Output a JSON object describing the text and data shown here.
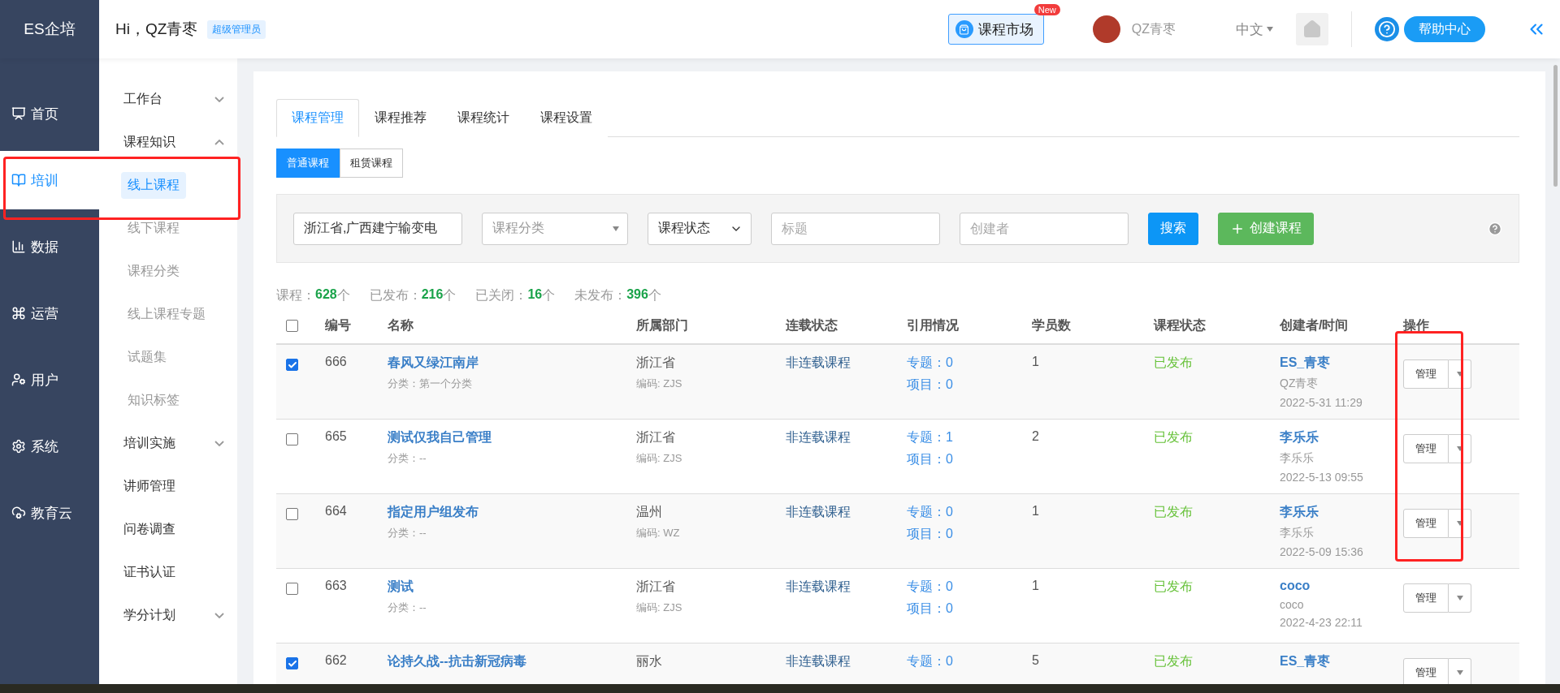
{
  "header": {
    "logo": "ES企培",
    "greeting": "Hi，QZ青枣",
    "role_badge": "超级管理员",
    "market_button": "课程市场",
    "market_badge": "New",
    "user_name": "QZ青枣",
    "language": "中文",
    "help_button": "帮助中心"
  },
  "nav": [
    {
      "label": "首页",
      "selected": false
    },
    {
      "label": "培训",
      "selected": true
    },
    {
      "label": "数据",
      "selected": false
    },
    {
      "label": "运营",
      "selected": false
    },
    {
      "label": "用户",
      "selected": false
    },
    {
      "label": "系统",
      "selected": false
    },
    {
      "label": "教育云",
      "selected": false
    }
  ],
  "subnav": [
    {
      "label": "工作台",
      "expanded": false
    },
    {
      "label": "课程知识",
      "expanded": true,
      "children": [
        {
          "label": "线上课程",
          "selected": true
        },
        {
          "label": "线下课程",
          "selected": false
        },
        {
          "label": "课程分类",
          "selected": false
        },
        {
          "label": "线上课程专题",
          "selected": false
        },
        {
          "label": "试题集",
          "selected": false
        },
        {
          "label": "知识标签",
          "selected": false
        }
      ]
    },
    {
      "label": "培训实施",
      "expanded": false
    },
    {
      "label": "讲师管理"
    },
    {
      "label": "问卷调查"
    },
    {
      "label": "证书认证"
    },
    {
      "label": "学分计划",
      "expanded": false
    }
  ],
  "tabs": [
    {
      "label": "课程管理",
      "selected": true
    },
    {
      "label": "课程推荐",
      "selected": false
    },
    {
      "label": "课程统计",
      "selected": false
    },
    {
      "label": "课程设置",
      "selected": false
    }
  ],
  "subtabs": [
    {
      "label": "普通课程",
      "selected": true
    },
    {
      "label": "租赁课程",
      "selected": false
    }
  ],
  "filters": {
    "department": "浙江省,广西建宁输变电",
    "category": "课程分类",
    "status": "课程状态",
    "title_placeholder": "标题",
    "creator_placeholder": "创建者",
    "search_button": "搜索",
    "create_button": "创建课程"
  },
  "stats": [
    {
      "label": "课程：",
      "value": "628",
      "unit": "个"
    },
    {
      "label": "已发布：",
      "value": "216",
      "unit": "个"
    },
    {
      "label": "已关闭：",
      "value": "16",
      "unit": "个"
    },
    {
      "label": "未发布：",
      "value": "396",
      "unit": "个"
    }
  ],
  "table": {
    "columns": [
      "编号",
      "名称",
      "所属部门",
      "连载状态",
      "引用情况",
      "学员数",
      "课程状态",
      "创建者/时间",
      "操作"
    ],
    "all_checked": false,
    "rows": [
      {
        "checked": true,
        "id": "666",
        "name": "春风又绿江南岸",
        "category": "分类：第一个分类",
        "dept": "浙江省",
        "dept_code": "编码: ZJS",
        "serial": "非连载课程",
        "topic": "专题：0",
        "project": "项目：0",
        "students": "1",
        "status": "已发布",
        "creator": "ES_青枣",
        "creator_sub": "QZ青枣",
        "time": "2022-5-31 11:29",
        "action": "管理"
      },
      {
        "checked": false,
        "id": "665",
        "name": "测试仅我自己管理",
        "category": "分类：--",
        "dept": "浙江省",
        "dept_code": "编码: ZJS",
        "serial": "非连载课程",
        "topic": "专题：1",
        "project": "项目：0",
        "students": "2",
        "status": "已发布",
        "creator": "李乐乐",
        "creator_sub": "李乐乐",
        "time": "2022-5-13 09:55",
        "action": "管理"
      },
      {
        "checked": false,
        "id": "664",
        "name": "指定用户组发布",
        "category": "分类：--",
        "dept": "温州",
        "dept_code": "编码: WZ",
        "serial": "非连载课程",
        "topic": "专题：0",
        "project": "项目：0",
        "students": "1",
        "status": "已发布",
        "creator": "李乐乐",
        "creator_sub": "李乐乐",
        "time": "2022-5-09 15:36",
        "action": "管理"
      },
      {
        "checked": false,
        "id": "663",
        "name": "测试",
        "category": "分类：--",
        "dept": "浙江省",
        "dept_code": "编码: ZJS",
        "serial": "非连载课程",
        "topic": "专题：0",
        "project": "项目：0",
        "students": "1",
        "status": "已发布",
        "creator": "coco",
        "creator_sub": "coco",
        "time": "2022-4-23 22:11",
        "action": "管理"
      },
      {
        "checked": true,
        "id": "662",
        "name": "论持久战--抗击新冠病毒",
        "dept": "丽水",
        "serial": "非连载课程",
        "topic": "专题：0",
        "students": "5",
        "status": "已发布",
        "creator": "ES_青枣",
        "action": "管理"
      }
    ]
  }
}
